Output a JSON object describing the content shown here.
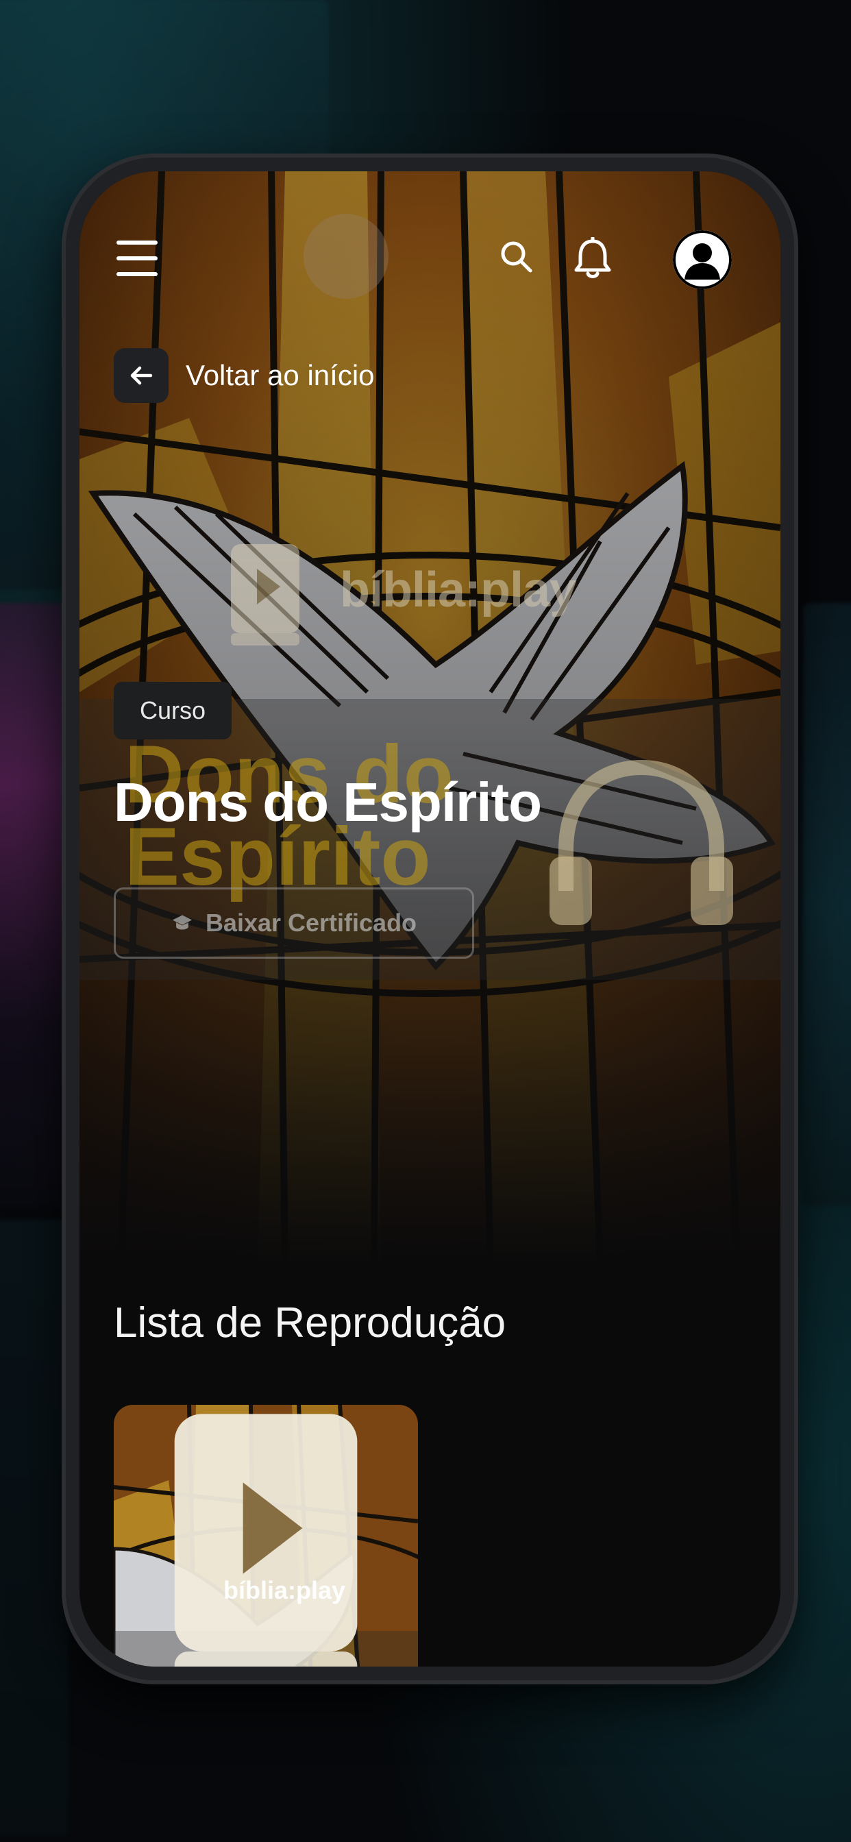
{
  "header": {
    "menu_icon": "hamburger-menu-icon",
    "search_icon": "search-icon",
    "notification_icon": "bell-icon",
    "profile_icon": "user-avatar-icon"
  },
  "navigation": {
    "back_label": "Voltar ao início",
    "back_icon": "arrow-left-icon"
  },
  "hero": {
    "brand_watermark": "bíblia:play",
    "cover_title_watermark": "Dons do Espírito",
    "cover_icon": "headphones-icon"
  },
  "course": {
    "tag": "Curso",
    "title": "Dons do Espírito",
    "certificate_button": "Baixar Certificado",
    "certificate_icon": "graduation-cap-icon"
  },
  "playlist": {
    "title": "Lista de Reprodução",
    "items": [
      {
        "brand": "bíblia:play"
      }
    ]
  },
  "colors": {
    "background": "#0a0a0b",
    "accent_gold": "#c8a014",
    "tag_bg": "#1e1f21"
  }
}
